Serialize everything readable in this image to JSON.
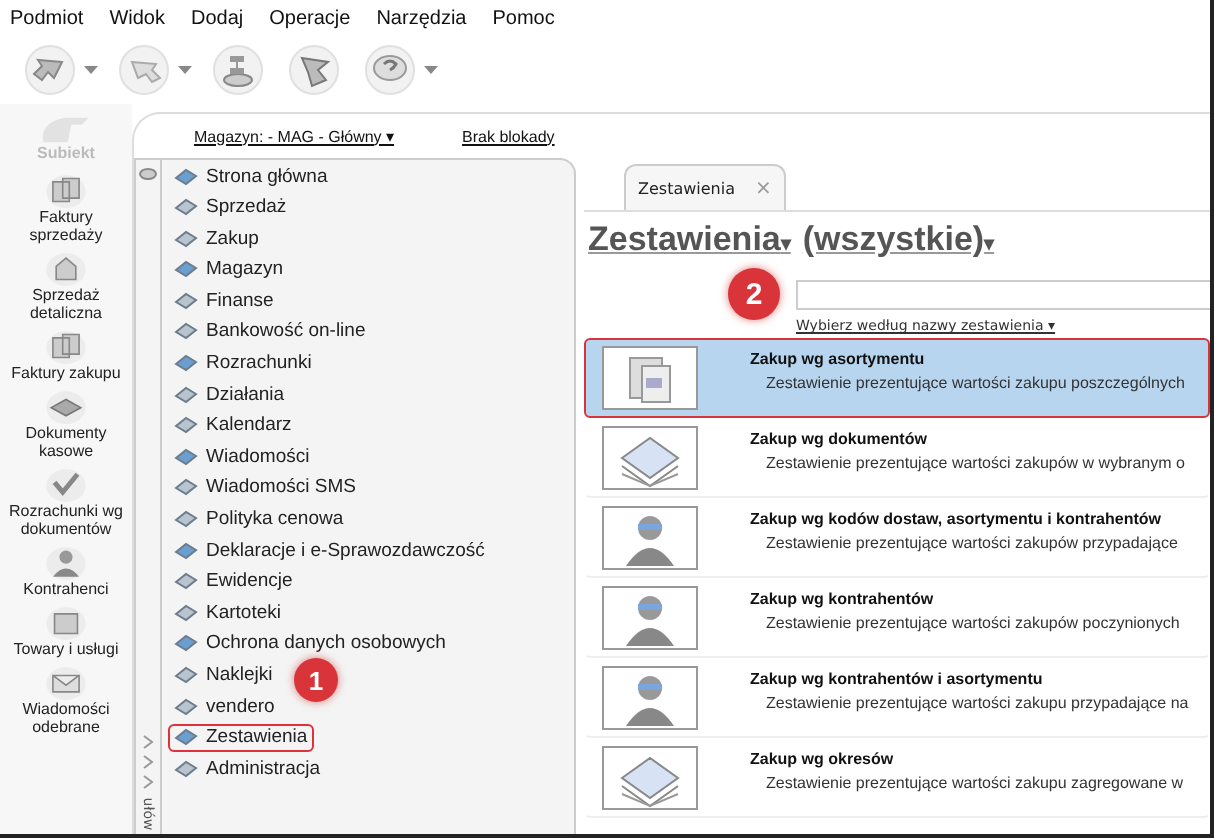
{
  "menu_bar": [
    "Podmiot",
    "Widok",
    "Dodaj",
    "Operacje",
    "Narzędzia",
    "Pomoc"
  ],
  "toolbar": [
    {
      "dropdown": true
    },
    {
      "dropdown": true
    },
    {
      "dropdown": false
    },
    {
      "dropdown": false
    },
    {
      "dropdown": true
    }
  ],
  "logo": "Subiekt",
  "modules": [
    "Faktury sprzedaży",
    "Sprzedaż detaliczna",
    "Faktury zakupu",
    "Dokumenty kasowe",
    "Rozrachunki wg dokumentów",
    "Kontrahenci",
    "Towary i usługi",
    "Wiadomości odebrane"
  ],
  "modules_footer": "ułów",
  "header": {
    "warehouse": "Magazyn: - MAG - Główny ▾",
    "lock": "Brak blokady"
  },
  "nav": [
    {
      "label": "Strona główna",
      "selected": false
    },
    {
      "label": "Sprzedaż",
      "selected": false
    },
    {
      "label": "Zakup",
      "selected": false
    },
    {
      "label": "Magazyn",
      "selected": false
    },
    {
      "label": "Finanse",
      "selected": false
    },
    {
      "label": "Bankowość on-line",
      "selected": false
    },
    {
      "label": "Rozrachunki",
      "selected": false
    },
    {
      "label": "Działania",
      "selected": false
    },
    {
      "label": "Kalendarz",
      "selected": false
    },
    {
      "label": "Wiadomości",
      "selected": false
    },
    {
      "label": "Wiadomości SMS",
      "selected": false
    },
    {
      "label": "Polityka cenowa",
      "selected": false
    },
    {
      "label": "Deklaracje i e-Sprawozdawczość",
      "selected": false
    },
    {
      "label": "Ewidencje",
      "selected": false
    },
    {
      "label": "Kartoteki",
      "selected": false
    },
    {
      "label": "Ochrona danych osobowych",
      "selected": false
    },
    {
      "label": "Naklejki",
      "selected": false
    },
    {
      "label": "vendero",
      "selected": false
    },
    {
      "label": "Zestawienia",
      "selected": true
    },
    {
      "label": "Administracja",
      "selected": false
    }
  ],
  "tab": {
    "label": "Zestawienia",
    "close": "×"
  },
  "heading": {
    "category": "Zestawienia",
    "category_caret": "▾",
    "filter": "(wszystkie)",
    "filter_caret": "▾"
  },
  "search": {
    "sort_link": "Wybierz według nazwy zestawienia ▾"
  },
  "reports": [
    {
      "title": "Zakup wg asortymentu",
      "description": "Zestawienie prezentujące wartości zakupu poszczególnych",
      "selected": true
    },
    {
      "title": "Zakup wg dokumentów",
      "description": "Zestawienie prezentujące wartości zakupów w wybranym o",
      "selected": false
    },
    {
      "title": "Zakup wg kodów dostaw, asortymentu i kontrahentów",
      "description": "Zestawienie prezentujące wartości zakupów przypadające",
      "selected": false
    },
    {
      "title": "Zakup wg kontrahentów",
      "description": "Zestawienie prezentujące wartości zakupów poczynionych",
      "selected": false
    },
    {
      "title": "Zakup wg kontrahentów i asortymentu",
      "description": "Zestawienie prezentujące wartości zakupu przypadające na",
      "selected": false
    },
    {
      "title": "Zakup wg okresów",
      "description": "Zestawienie prezentujące wartości zakupu zagregowane w",
      "selected": false
    }
  ],
  "callouts": [
    "1",
    "2"
  ]
}
